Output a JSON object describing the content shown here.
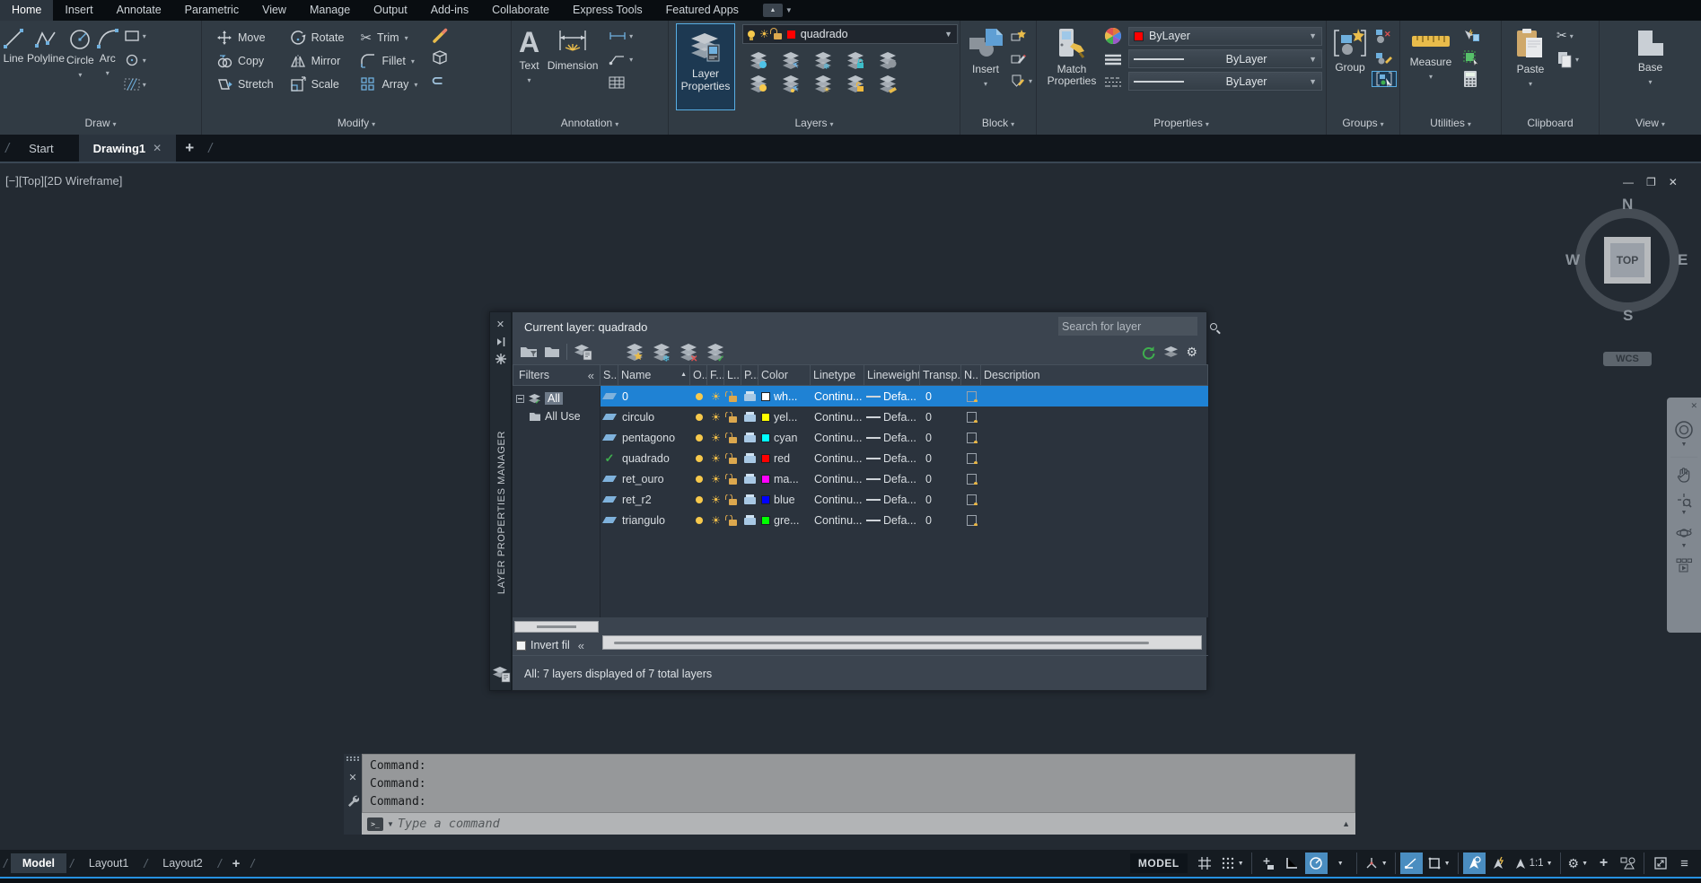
{
  "colors": {
    "accent_blue": "#58aee4",
    "selection_blue": "#1f82d4",
    "icon_yellow": "#e9bc4b",
    "current_layer_swatch": "#ff0000",
    "command_gray": "#96989a",
    "status_line_blue": "#2691e0"
  },
  "menubar": {
    "items": [
      "Home",
      "Insert",
      "Annotate",
      "Parametric",
      "View",
      "Manage",
      "Output",
      "Add-ins",
      "Collaborate",
      "Express Tools",
      "Featured Apps"
    ],
    "active": "Home"
  },
  "ribbon": {
    "draw": {
      "label": "Draw",
      "tools": [
        "Line",
        "Polyline",
        "Circle",
        "Arc"
      ]
    },
    "modify": {
      "label": "Modify",
      "tools": [
        "Move",
        "Copy",
        "Stretch",
        "Rotate",
        "Mirror",
        "Scale",
        "Trim",
        "Fillet",
        "Array"
      ]
    },
    "annotation": {
      "label": "Annotation",
      "tools": [
        "Text",
        "Dimension"
      ]
    },
    "layers": {
      "label": "Layers",
      "layer_properties": "Layer Properties",
      "current_layer": "quadrado"
    },
    "block": {
      "label": "Block",
      "insert": "Insert"
    },
    "properties": {
      "label": "Properties",
      "match_properties": "Match Properties",
      "object_color": "ByLayer",
      "lineweight": "ByLayer",
      "linetype": "ByLayer"
    },
    "groups": {
      "label": "Groups",
      "group": "Group"
    },
    "utilities": {
      "label": "Utilities",
      "measure": "Measure"
    },
    "clipboard": {
      "label": "Clipboard",
      "paste": "Paste"
    },
    "view": {
      "label": "View",
      "base": "Base"
    }
  },
  "file_tabs": {
    "start": "Start",
    "drawing": "Drawing1"
  },
  "viewport": {
    "controls": "[−][Top][2D Wireframe]",
    "viewcube": {
      "n": "N",
      "e": "E",
      "s": "S",
      "w": "W",
      "face": "TOP"
    },
    "wcs": "WCS"
  },
  "palette": {
    "title_vertical": "LAYER PROPERTIES MANAGER",
    "current_layer_label": "Current layer: quadrado",
    "search_placeholder": "Search for layer",
    "filters_header": "Filters",
    "tree": [
      {
        "label": "All",
        "selected": true
      },
      {
        "label": "All Use",
        "selected": false
      }
    ],
    "columns": [
      "S..",
      "Name",
      "O..",
      "F...",
      "L...",
      "P...",
      "Color",
      "Linetype",
      "Lineweight",
      "Transp...",
      "N..",
      "Description"
    ],
    "rows": [
      {
        "name": "0",
        "selected": true,
        "current": false,
        "color_hex": "#ffffff",
        "color_label": "wh...",
        "linetype": "Continu...",
        "lineweight": "Defa...",
        "transparency": "0"
      },
      {
        "name": "circulo",
        "selected": false,
        "current": false,
        "color_hex": "#ffff00",
        "color_label": "yel...",
        "linetype": "Continu...",
        "lineweight": "Defa...",
        "transparency": "0"
      },
      {
        "name": "pentagono",
        "selected": false,
        "current": false,
        "color_hex": "#00ffff",
        "color_label": "cyan",
        "linetype": "Continu...",
        "lineweight": "Defa...",
        "transparency": "0"
      },
      {
        "name": "quadrado",
        "selected": false,
        "current": true,
        "color_hex": "#ff0000",
        "color_label": "red",
        "linetype": "Continu...",
        "lineweight": "Defa...",
        "transparency": "0"
      },
      {
        "name": "ret_ouro",
        "selected": false,
        "current": false,
        "color_hex": "#ff00ff",
        "color_label": "ma...",
        "linetype": "Continu...",
        "lineweight": "Defa...",
        "transparency": "0"
      },
      {
        "name": "ret_r2",
        "selected": false,
        "current": false,
        "color_hex": "#0000ff",
        "color_label": "blue",
        "linetype": "Continu...",
        "lineweight": "Defa...",
        "transparency": "0"
      },
      {
        "name": "triangulo",
        "selected": false,
        "current": false,
        "color_hex": "#00ff00",
        "color_label": "gre...",
        "linetype": "Continu...",
        "lineweight": "Defa...",
        "transparency": "0"
      }
    ],
    "invert_filter_label": "Invert fil",
    "status_text": "All: 7 layers displayed of 7 total layers"
  },
  "command": {
    "history": [
      "Command:",
      "Command:",
      "Command:"
    ],
    "placeholder": "Type a command"
  },
  "statusbar": {
    "tabs": [
      "Model",
      "Layout1",
      "Layout2"
    ],
    "active_tab": "Model",
    "model_space": "MODEL",
    "annotation_scale": "1:1"
  },
  "icons": {
    "search-icon": "magnifier",
    "gear-icon": "⚙",
    "refresh-icon": "↻ (green)",
    "close-icon": "✕",
    "minimize-icon": "−",
    "restore-icon": "❐",
    "bulb-icon": "yellow circle lamp",
    "sun-icon": "☀",
    "unlock-icon": "open padlock",
    "printer-icon": "printer shape",
    "check-icon": "✓",
    "sort-asc-icon": "▲",
    "caret-down-icon": "▾",
    "collapse-chevron-icon": "«",
    "snowflake-icon": "❄",
    "star-icon": "★",
    "scissors-icon": "✂",
    "plus-icon": "+",
    "hamburger-icon": "≡"
  }
}
